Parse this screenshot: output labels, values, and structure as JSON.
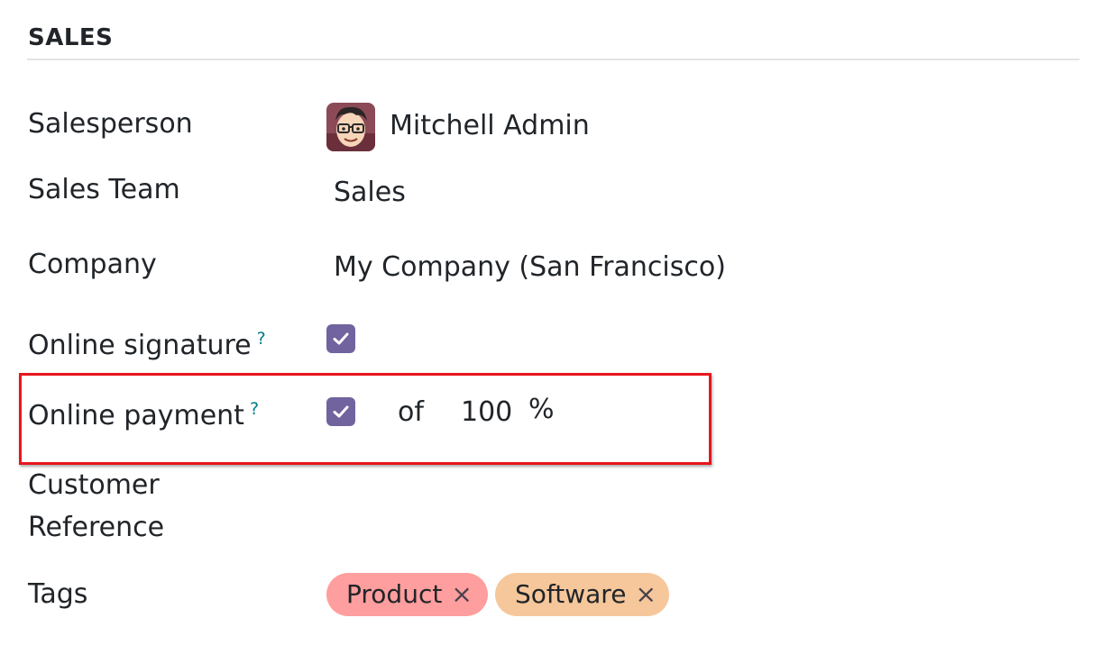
{
  "section": {
    "title": "SALES"
  },
  "fields": {
    "salesperson": {
      "label": "Salesperson",
      "value": "Mitchell Admin"
    },
    "sales_team": {
      "label": "Sales Team",
      "value": "Sales"
    },
    "company": {
      "label": "Company",
      "value": "My Company (San Francisco)"
    },
    "online_signature": {
      "label": "Online signature",
      "help": "?",
      "checked": true
    },
    "online_payment": {
      "label": "Online payment",
      "help": "?",
      "checked": true,
      "of_text": "of",
      "percent_value": "100",
      "percent_sign": "%"
    },
    "customer_reference": {
      "label_line1": "Customer",
      "label_line2": "Reference",
      "value": ""
    },
    "tags": {
      "label": "Tags",
      "items": [
        {
          "label": "Product",
          "remove_icon": "×",
          "color": "#ff9e9e"
        },
        {
          "label": "Software",
          "remove_icon": "×",
          "color": "#f6c79b"
        }
      ]
    }
  },
  "colors": {
    "checkbox": "#71639e",
    "help_link": "#017e84",
    "highlight": "#e8151d"
  }
}
